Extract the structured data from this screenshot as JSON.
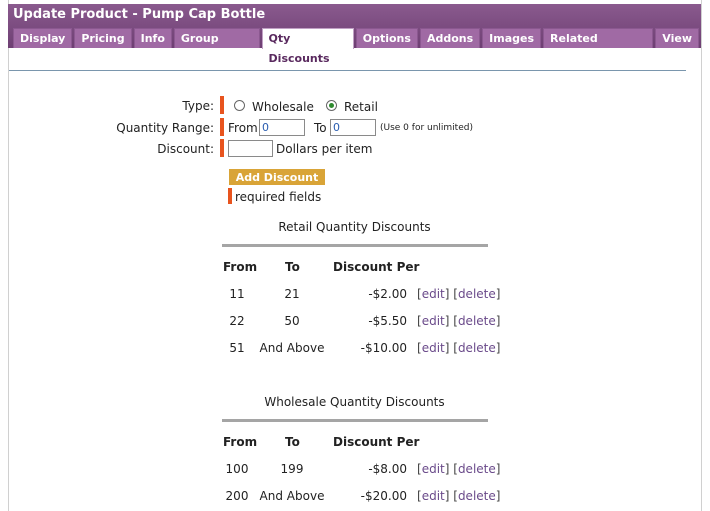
{
  "header": {
    "title": "Update Product - Pump Cap Bottle",
    "tabs": [
      {
        "label": "Display",
        "active": false
      },
      {
        "label": "Pricing",
        "active": false
      },
      {
        "label": "Info",
        "active": false
      },
      {
        "label": "Group Prices",
        "active": false
      },
      {
        "label": "Qty Discounts",
        "active": true
      },
      {
        "label": "Options",
        "active": false
      },
      {
        "label": "Addons",
        "active": false
      },
      {
        "label": "Images",
        "active": false
      },
      {
        "label": "Related Products",
        "active": false
      },
      {
        "label": "View",
        "active": false
      }
    ]
  },
  "form": {
    "type_label": "Type:",
    "type_options": [
      "Wholesale",
      "Retail"
    ],
    "type_selected": "Retail",
    "qty_label": "Quantity Range:",
    "from_label": "From",
    "from_value": "0",
    "to_label": "To",
    "to_value": "0",
    "unlimited_note": "(Use 0 for unlimited)",
    "discount_label": "Discount:",
    "discount_value": "",
    "discount_unit": "Dollars per item",
    "add_button": "Add Discount",
    "required_note": "required fields"
  },
  "retail": {
    "title": "Retail Quantity Discounts",
    "headers": [
      "From",
      "To",
      "Discount Per"
    ],
    "rows": [
      {
        "from": "11",
        "to": "21",
        "discount": "-$2.00"
      },
      {
        "from": "22",
        "to": "50",
        "discount": "-$5.50"
      },
      {
        "from": "51",
        "to": "And Above",
        "discount": "-$10.00"
      }
    ]
  },
  "wholesale": {
    "title": "Wholesale Quantity Discounts",
    "headers": [
      "From",
      "To",
      "Discount Per"
    ],
    "rows": [
      {
        "from": "100",
        "to": "199",
        "discount": "-$8.00"
      },
      {
        "from": "200",
        "to": "And Above",
        "discount": "-$20.00"
      }
    ]
  },
  "row_actions": {
    "edit": "edit",
    "delete": "delete"
  },
  "colors": {
    "header": "#7a4a7e",
    "tab": "#a06aa4",
    "required_marker": "#e8541e",
    "button": "#d9a437"
  }
}
